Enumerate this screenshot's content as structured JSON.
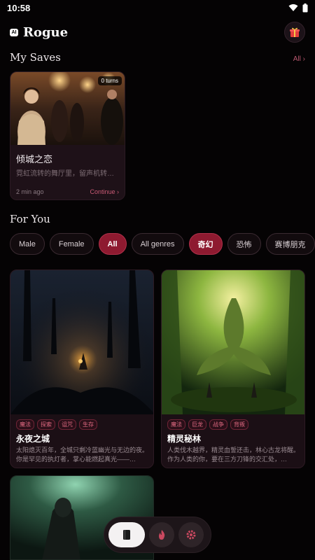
{
  "status": {
    "time": "10:58",
    "icons": [
      "wifi-icon",
      "battery-icon"
    ]
  },
  "header": {
    "badge": "AI",
    "title": "Rogue",
    "gift_icon": "gift-icon"
  },
  "saves": {
    "title": "My Saves",
    "all_label": "All ›",
    "items": [
      {
        "turns": "0 turns",
        "title": "倾城之恋",
        "desc": "霓虹流转的舞厅里，留声机转…",
        "time": "2 min ago",
        "continue": "Continue ›"
      }
    ]
  },
  "for_you": {
    "title": "For You",
    "filters": [
      {
        "label": "Male",
        "active": false
      },
      {
        "label": "Female",
        "active": false
      },
      {
        "label": "All",
        "active": true
      },
      {
        "label": "All genres",
        "active": false
      },
      {
        "label": "奇幻",
        "active": true
      },
      {
        "label": "恐怖",
        "active": false
      },
      {
        "label": "赛博朋克",
        "active": false
      },
      {
        "label": "",
        "active": true
      }
    ],
    "stories": [
      {
        "tags": [
          "魔法",
          "探索",
          "诅咒",
          "生存"
        ],
        "title": "永夜之城",
        "desc": "太阳熄灭百年，全城只剩冷蓝幽光与无边的夜。你是罕见的执灯者，掌心能燃起真光——…"
      },
      {
        "tags": [
          "魔法",
          "巨龙",
          "战争",
          "背叛"
        ],
        "title": "精灵秘林",
        "desc": "人类伐木越界，精灵血誓还击，林心古龙将醒。作为人类的你，要在三方刀锋的交汇处，…"
      }
    ]
  },
  "nav": {
    "items": [
      "book-icon",
      "flame-icon",
      "gear-icon"
    ]
  },
  "colors": {
    "accent": "#8e1a30",
    "background": "#050304",
    "link": "#c85a74"
  }
}
